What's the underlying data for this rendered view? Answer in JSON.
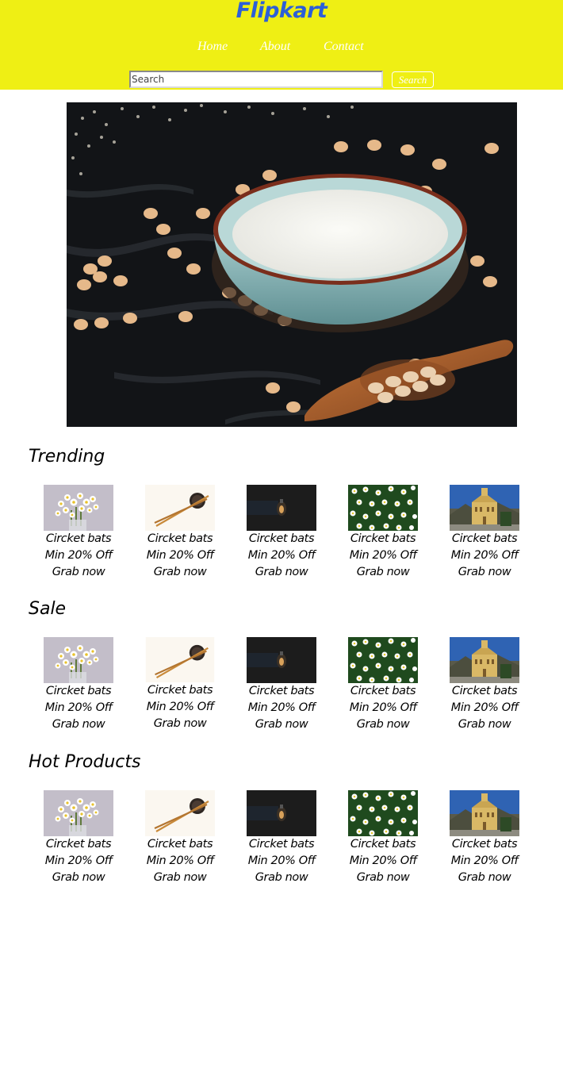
{
  "header": {
    "logo": "Flipkart",
    "nav": [
      {
        "label": "Home"
      },
      {
        "label": "About"
      },
      {
        "label": "Contact"
      }
    ],
    "search": {
      "placeholder": "Search",
      "value": "",
      "button_label": "Search"
    },
    "background_color": "#efef14",
    "logo_color": "#2c5fd8"
  },
  "hero": {
    "image_subject": "bowl of milk with soybeans and wooden scoop on dark table"
  },
  "sections": [
    {
      "title": "Trending",
      "products": [
        {
          "name": "Circket bats",
          "offer": "Min 20% Off",
          "cta": "Grab now",
          "image": "daisies-in-vase"
        },
        {
          "name": "Circket bats",
          "offer": "Min 20% Off",
          "cta": "Grab now",
          "image": "chopsticks"
        },
        {
          "name": "Circket bats",
          "offer": "Min 20% Off",
          "cta": "Grab now",
          "image": "light-bulb"
        },
        {
          "name": "Circket bats",
          "offer": "Min 20% Off",
          "cta": "Grab now",
          "image": "daisy-field"
        },
        {
          "name": "Circket bats",
          "offer": "Min 20% Off",
          "cta": "Grab now",
          "image": "church-building"
        }
      ]
    },
    {
      "title": "Sale",
      "products": [
        {
          "name": "Circket bats",
          "offer": "Min 20% Off",
          "cta": "Grab now",
          "image": "daisies-in-vase"
        },
        {
          "name": "Circket bats",
          "offer": "Min 20% Off",
          "cta": "Grab now",
          "image": "chopsticks"
        },
        {
          "name": "Circket bats",
          "offer": "Min 20% Off",
          "cta": "Grab now",
          "image": "light-bulb"
        },
        {
          "name": "Circket bats",
          "offer": "Min 20% Off",
          "cta": "Grab now",
          "image": "daisy-field"
        },
        {
          "name": "Circket bats",
          "offer": "Min 20% Off",
          "cta": "Grab now",
          "image": "church-building"
        }
      ]
    },
    {
      "title": "Hot Products",
      "products": [
        {
          "name": "Circket bats",
          "offer": "Min 20% Off",
          "cta": "Grab now",
          "image": "daisies-in-vase"
        },
        {
          "name": "Circket bats",
          "offer": "Min 20% Off",
          "cta": "Grab now",
          "image": "chopsticks"
        },
        {
          "name": "Circket bats",
          "offer": "Min 20% Off",
          "cta": "Grab now",
          "image": "light-bulb"
        },
        {
          "name": "Circket bats",
          "offer": "Min 20% Off",
          "cta": "Grab now",
          "image": "daisy-field"
        },
        {
          "name": "Circket bats",
          "offer": "Min 20% Off",
          "cta": "Grab now",
          "image": "church-building"
        }
      ]
    }
  ]
}
